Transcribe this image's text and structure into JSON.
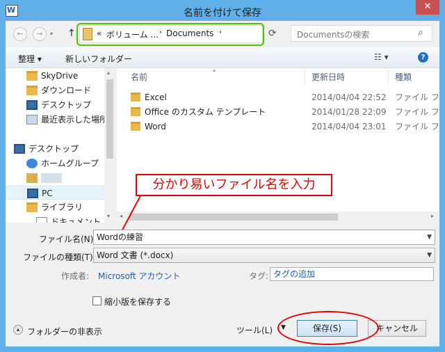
{
  "window": {
    "title": "名前を付けて保存",
    "close": "✕"
  },
  "nav": {
    "back": "←",
    "forward": "→",
    "up": "↑",
    "refresh": "⟳"
  },
  "address": {
    "sep1": "«",
    "crumb1": "ボリューム ...",
    "crumb2": "Documents",
    "arrow": "›"
  },
  "search": {
    "placeholder": "Documentsの検索"
  },
  "toolbar": {
    "organize": "整理 ▾",
    "new_folder": "新しいフォルダー",
    "view": "☷ ▾",
    "help": "?"
  },
  "sidebar": {
    "items": [
      {
        "label": "SkyDrive",
        "icon": "folder-icon"
      },
      {
        "label": "ダウンロード",
        "icon": "download-icon"
      },
      {
        "label": "デスクトップ",
        "icon": "desktop-icon"
      },
      {
        "label": "最近表示した場所",
        "icon": "recent-icon"
      },
      {
        "label": "デスクトップ",
        "icon": "desktop-icon"
      },
      {
        "label": "ホームグループ",
        "icon": "homegroup-icon"
      },
      {
        "label": "",
        "icon": "user-icon"
      },
      {
        "label": "PC",
        "icon": "pc-icon"
      },
      {
        "label": "ライブラリ",
        "icon": "library-icon"
      },
      {
        "label": "ドキュメント",
        "icon": "document-icon"
      }
    ]
  },
  "columns": {
    "name": "名前",
    "date": "更新日時",
    "type": "種類"
  },
  "files": [
    {
      "name": "Excel",
      "date": "2014/04/04 22:52",
      "type": "ファイル フォル"
    },
    {
      "name": "Office のカスタム テンプレート",
      "date": "2014/01/28 22:09",
      "type": "ファイル フォル"
    },
    {
      "name": "Word",
      "date": "2014/04/04 23:01",
      "type": "ファイル フォル"
    }
  ],
  "form": {
    "filename_label": "ファイル名(N):",
    "filename_value": "Wordの練習",
    "filetype_label": "ファイルの種類(T):",
    "filetype_value": "Word 文書 (*.docx)",
    "author_label": "作成者:",
    "author_value": "Microsoft アカウント",
    "tag_label": "タグ:",
    "tag_value": "タグの追加",
    "thumbnail_label": "縮小版を保存する"
  },
  "footer": {
    "hide_folders": "フォルダーの非表示",
    "tools": "ツール(L)",
    "save": "保存(S)",
    "cancel": "キャンセル"
  },
  "annotation": {
    "callout": "分かり易いファイル名を入力"
  },
  "colors": {
    "title_bar": "#5fb0e8",
    "annotation_red": "#e00000",
    "highlight_green": "#45c400"
  }
}
